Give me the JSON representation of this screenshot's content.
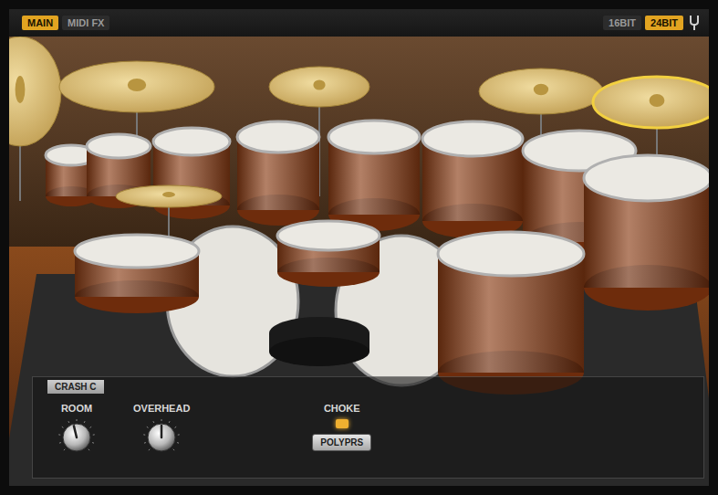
{
  "tabs": [
    {
      "label": "MAIN",
      "selected": true
    },
    {
      "label": "MIDI FX",
      "selected": false
    }
  ],
  "bit_depth": [
    {
      "label": "16BIT",
      "selected": false
    },
    {
      "label": "24BIT",
      "selected": true
    }
  ],
  "instrument_panel": {
    "title": "CRASH C",
    "knobs": [
      {
        "label": "ROOM",
        "level": 0.45
      },
      {
        "label": "OVERHEAD",
        "level": 0.5
      }
    ],
    "choke": {
      "label": "CHOKE",
      "on": true
    },
    "choke_mode": "POLYPRS"
  }
}
